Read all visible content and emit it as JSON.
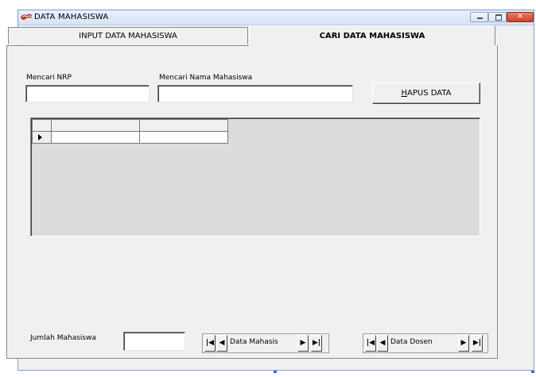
{
  "window": {
    "title": "DATA MAHASISWA",
    "minimize_glyph": "",
    "maximize_glyph": "",
    "close_glyph": "✕"
  },
  "tabs": [
    {
      "label": "INPUT DATA MAHASISWA",
      "active": false
    },
    {
      "label": "CARI DATA MAHASISWA",
      "active": true
    }
  ],
  "search": {
    "nrp_label": "Mencari NRP",
    "nrp_value": "",
    "nama_label": "Mencari Nama Mahasiswa",
    "nama_value": ""
  },
  "buttons": {
    "hapus_prefix": "H",
    "hapus_rest": "APUS DATA"
  },
  "footer": {
    "jumlah_label": "Jumlah Mahasiswa",
    "jumlah_value": "",
    "nav_mahasiswa_caption": "Data Mahasis",
    "nav_dosen_caption": "Data Dosen"
  },
  "nav_glyphs": {
    "first": "|◀",
    "prev": "◀",
    "next": "▶",
    "last": "▶|"
  },
  "colors": {
    "window_bg": "#f0f0f0",
    "title_gradient_top": "#eaf1fb",
    "close_red": "#c9412b",
    "selection_handle": "#2f6fd6"
  }
}
